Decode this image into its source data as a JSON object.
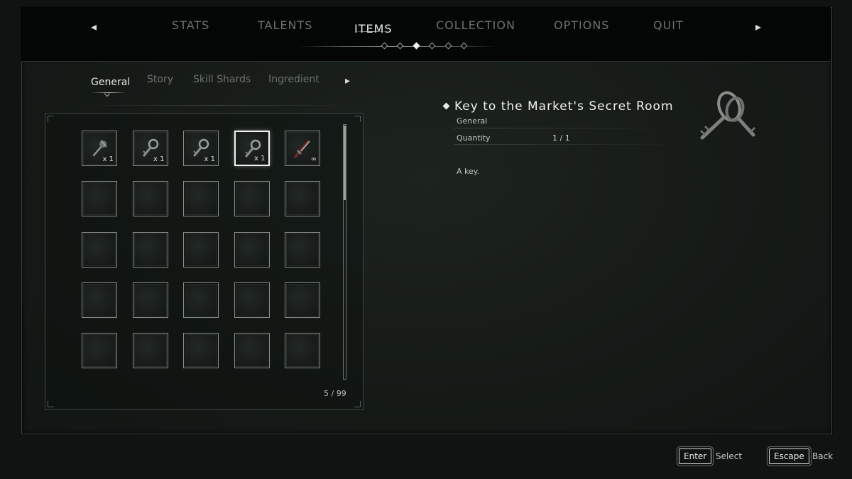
{
  "top_tabs": [
    "STATS",
    "TALENTS",
    "ITEMS",
    "COLLECTION",
    "OPTIONS",
    "QUIT"
  ],
  "active_top_tab": "ITEMS",
  "sub_tabs": [
    "General",
    "Story",
    "Skill Shards",
    "Ingredient"
  ],
  "active_sub_tab": "General",
  "inventory": {
    "slots": [
      {
        "icon": "mace-icon",
        "qty": "x 1"
      },
      {
        "icon": "key-icon",
        "qty": "x 1"
      },
      {
        "icon": "key-icon",
        "qty": "x 1"
      },
      {
        "icon": "key-icon",
        "qty": "x 1",
        "selected": true
      },
      {
        "icon": "dagger-icon",
        "qty": "∞"
      }
    ],
    "total_slots_visible": 25,
    "count_label": "5 / 99",
    "scroll_position": 0.0
  },
  "detail": {
    "title": "Key to the Market's Secret Room",
    "category": "General",
    "quantity_label": "Quantity",
    "quantity_value": "1 / 1",
    "description": "A key.",
    "icon": "key-ring-icon"
  },
  "hints": {
    "select_key": "Enter",
    "select_label": "Select",
    "back_key": "Escape",
    "back_label": "Back"
  },
  "colors": {
    "background": "#0f1311",
    "topbar": "#040505",
    "text_active": "#e8ebe8",
    "text_inactive": "#6c716e",
    "slot_border": "#8a908c"
  }
}
